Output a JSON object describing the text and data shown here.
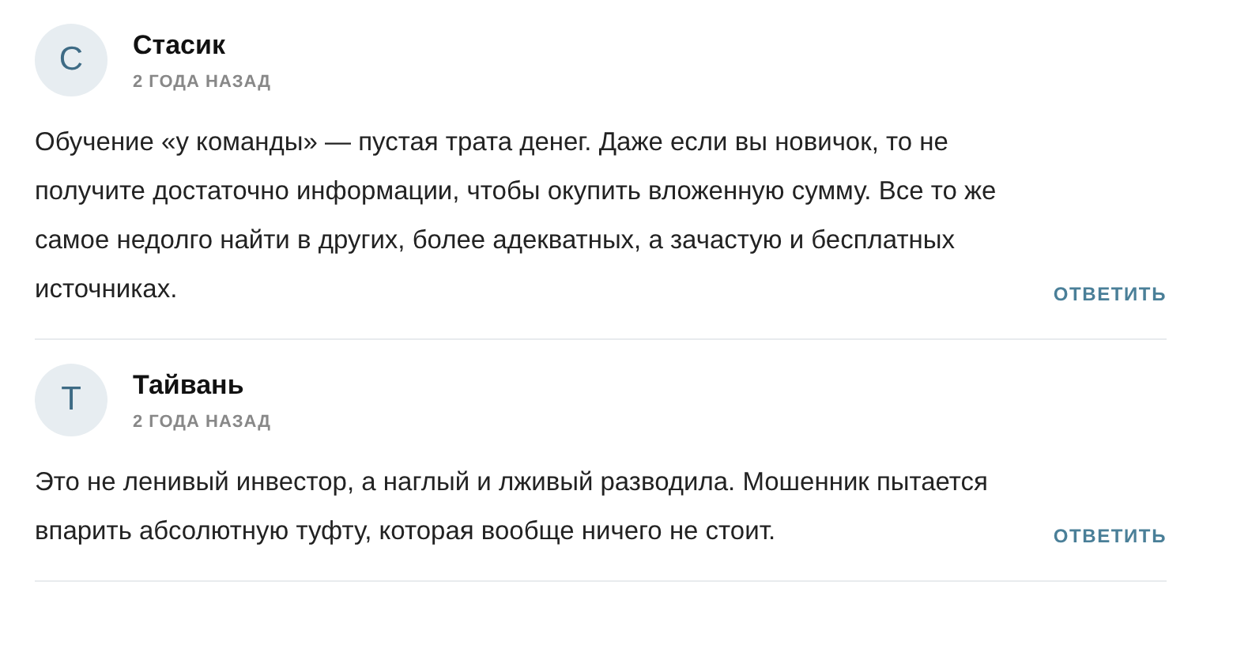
{
  "comments": [
    {
      "initial": "С",
      "author": "Стасик",
      "date": "2 ГОДА НАЗАД",
      "text": "Обучение «у команды» — пустая трата денег. Даже если вы новичок, то не получите достаточно информации, чтобы окупить вложенную сумму. Все то же самое недолго найти в других, более адекватных, а зачастую и бесплатных источниках.",
      "reply": "ОТВЕТИТЬ"
    },
    {
      "initial": "Т",
      "author": "Тайвань",
      "date": "2 ГОДА НАЗАД",
      "text": "Это не ленивый инвестор, а наглый и лживый разводила. Мошенник пытается впарить абсолютную туфту, которая вообще ничего не стоит.",
      "reply": "ОТВЕТИТЬ"
    }
  ]
}
